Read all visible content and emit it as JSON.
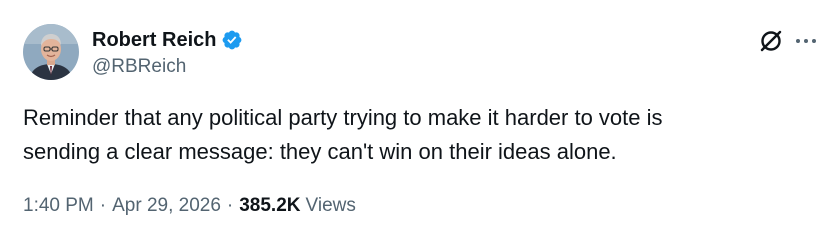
{
  "author": {
    "display_name": "Robert Reich",
    "handle": "@RBReich",
    "verified": true,
    "verified_color": "#1d9bf0",
    "avatar_icon": "profile-photo"
  },
  "header_actions": {
    "grok_icon": "grok-slashed-circle-icon",
    "more_icon": "more-horizontal-icon"
  },
  "tweet": {
    "text": "Reminder that any political party trying to make it harder to vote is\nsending a clear message: they can't win on their ideas alone."
  },
  "meta": {
    "time": "1:40 PM",
    "separator": "·",
    "date": "Apr 29, 2026",
    "views_count": "385.2K",
    "views_label": "Views"
  },
  "colors": {
    "text_primary": "#0f1419",
    "text_secondary": "#536471",
    "background": "#ffffff"
  }
}
